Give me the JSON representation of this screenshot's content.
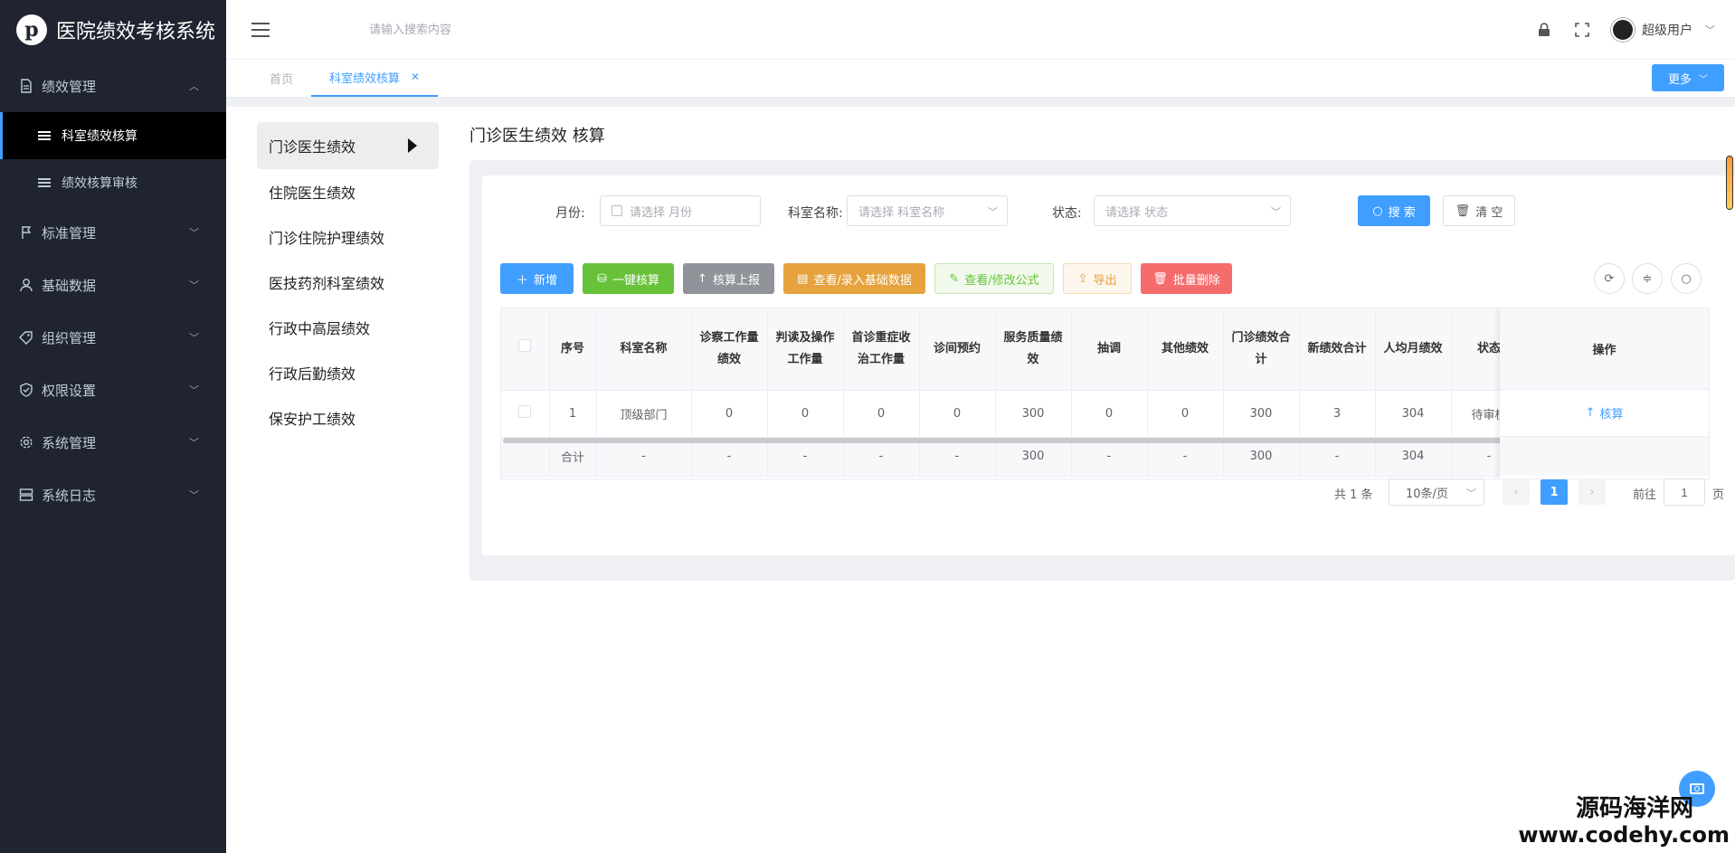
{
  "app": {
    "title": "医院绩效考核系统",
    "logo_letter": "p"
  },
  "header": {
    "search_placeholder": "请输入搜索内容",
    "user_name": "超级用户"
  },
  "sidebar": {
    "groups": [
      {
        "label": "绩效管理",
        "icon": "document-icon",
        "expanded": true,
        "items": [
          {
            "label": "科室绩效核算",
            "active": true
          },
          {
            "label": "绩效核算审核",
            "active": false
          }
        ]
      },
      {
        "label": "标准管理",
        "icon": "flag-icon"
      },
      {
        "label": "基础数据",
        "icon": "user-icon"
      },
      {
        "label": "组织管理",
        "icon": "tag-icon"
      },
      {
        "label": "权限设置",
        "icon": "shield-check-icon"
      },
      {
        "label": "系统管理",
        "icon": "gear-icon"
      },
      {
        "label": "系统日志",
        "icon": "server-icon"
      }
    ]
  },
  "tabs": [
    {
      "label": "首页"
    },
    {
      "label": "科室绩效核算",
      "active": true
    }
  ],
  "more_label": "更多",
  "categories": [
    "门诊医生绩效",
    "住院医生绩效",
    "门诊住院护理绩效",
    "医技药剂科室绩效",
    "行政中高层绩效",
    "行政后勤绩效",
    "保安护工绩效"
  ],
  "page_title": "门诊医生绩效 核算",
  "filters": {
    "month_label": "月份:",
    "month_placeholder": "请选择 月份",
    "dept_label": "科室名称:",
    "dept_placeholder": "请选择 科室名称",
    "status_label": "状态:",
    "status_placeholder": "请选择 状态",
    "search_btn": "搜 索",
    "clear_btn": "清 空"
  },
  "toolbar": {
    "add": "新增",
    "one_click": "一键核算",
    "report": "核算上报",
    "view_base": "查看/录入基础数据",
    "view_formula": "查看/修改公式",
    "export": "导出",
    "batch_delete": "批量删除"
  },
  "colors": {
    "primary": "#409eff",
    "success": "#67c23a",
    "info": "#909399",
    "warning": "#e6a23c",
    "danger": "#f56c6c",
    "sidebar_bg": "#1f2430"
  },
  "table": {
    "headers": [
      "序号",
      "科室名称",
      "诊察工作量绩效",
      "判读及操作工作量",
      "首诊重症收治工作量",
      "诊间预约",
      "服务质量绩效",
      "抽调",
      "其他绩效",
      "门诊绩效合计",
      "新绩效合计",
      "人均月绩效",
      "状态"
    ],
    "op_header": "操作",
    "rows": [
      [
        "1",
        "顶级部门",
        "0",
        "0",
        "0",
        "0",
        "300",
        "0",
        "0",
        "300",
        "3",
        "304",
        "待审核"
      ]
    ],
    "op_label": "核算",
    "summary": [
      "合计",
      "-",
      "-",
      "-",
      "-",
      "-",
      "300",
      "-",
      "-",
      "300",
      "-",
      "304",
      "-"
    ]
  },
  "pagination": {
    "total": "共 1 条",
    "page_size": "10条/页",
    "current": "1",
    "goto_label": "前往",
    "goto_value": "1",
    "page_suffix": "页"
  },
  "watermark": {
    "line1": "源码海洋网",
    "line2": "www.codehy.com"
  }
}
